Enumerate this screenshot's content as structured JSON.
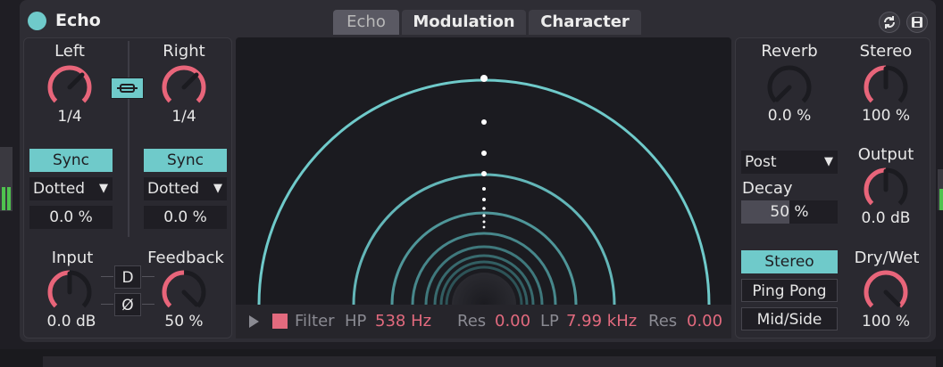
{
  "device": {
    "title": "Echo"
  },
  "tabs": [
    {
      "label": "Echo",
      "active": true
    },
    {
      "label": "Modulation",
      "active": false
    },
    {
      "label": "Character",
      "active": false
    }
  ],
  "left": {
    "left_label": "Left",
    "right_label": "Right",
    "left_value": "1/4",
    "right_value": "1/4",
    "left_sync": "Sync",
    "right_sync": "Sync",
    "left_mode": "Dotted",
    "right_mode": "Dotted",
    "left_offset": "0.0 %",
    "right_offset": "0.0 %",
    "input_label": "Input",
    "input_value": "0.0 dB",
    "feedback_label": "Feedback",
    "feedback_value": "50 %",
    "d_label": "D",
    "phase_label": "Ø"
  },
  "filter": {
    "title": "Filter",
    "hp_label": "HP",
    "hp_value": "538 Hz",
    "res1_label": "Res",
    "res1_value": "0.00",
    "lp_label": "LP",
    "lp_value": "7.99 kHz",
    "res2_label": "Res",
    "res2_value": "0.00"
  },
  "right": {
    "reverb_label": "Reverb",
    "reverb_value": "0.0 %",
    "stereo_label": "Stereo",
    "stereo_value": "100 %",
    "position": "Post",
    "decay_label": "Decay",
    "decay_value": "50 %",
    "output_label": "Output",
    "output_value": "0.0 dB",
    "mode_stereo": "Stereo",
    "mode_pingpong": "Ping Pong",
    "mode_midside": "Mid/Side",
    "drywet_label": "Dry/Wet",
    "drywet_value": "100 %"
  },
  "colors": {
    "accent": "#6fcaca",
    "knob": "#e8657a",
    "value": "#e26a7e"
  },
  "icons": {
    "hot_swap": "hot-swap-icon",
    "save": "save-icon",
    "play": "play-icon",
    "link": "link-icon"
  }
}
